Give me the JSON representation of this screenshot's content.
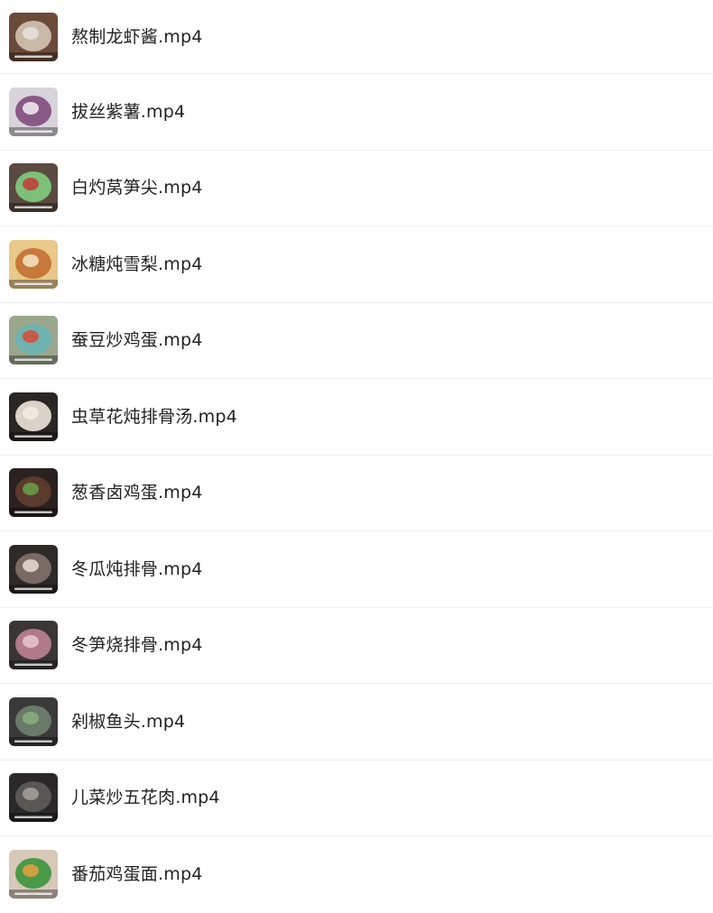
{
  "files": [
    {
      "name": "熬制龙虾酱.mp4",
      "thumb_bg": "#6b4a3a",
      "thumb_fg": "#c9b8a8",
      "thumb_accent": "#e8e2dc",
      "icon": "video-thumbnail-icon"
    },
    {
      "name": "拔丝紫薯.mp4",
      "thumb_bg": "#d9d4dc",
      "thumb_fg": "#8a5a86",
      "thumb_accent": "#f2eef2",
      "icon": "video-thumbnail-icon"
    },
    {
      "name": "白灼莴笋尖.mp4",
      "thumb_bg": "#5b4a3f",
      "thumb_fg": "#7cc07a",
      "thumb_accent": "#c43a3a",
      "icon": "video-thumbnail-icon"
    },
    {
      "name": "冰糖炖雪梨.mp4",
      "thumb_bg": "#e8c98a",
      "thumb_fg": "#c8783a",
      "thumb_accent": "#f4e6c2",
      "icon": "video-thumbnail-icon"
    },
    {
      "name": "蚕豆炒鸡蛋.mp4",
      "thumb_bg": "#9aa78c",
      "thumb_fg": "#6fb3b0",
      "thumb_accent": "#d84a3a",
      "icon": "video-thumbnail-icon"
    },
    {
      "name": "虫草花炖排骨汤.mp4",
      "thumb_bg": "#2a2624",
      "thumb_fg": "#d9d2c8",
      "thumb_accent": "#f2ede6",
      "icon": "video-thumbnail-icon"
    },
    {
      "name": "葱香卤鸡蛋.mp4",
      "thumb_bg": "#2a2220",
      "thumb_fg": "#5a3a2c",
      "thumb_accent": "#6aa04a",
      "icon": "video-thumbnail-icon"
    },
    {
      "name": "冬瓜炖排骨.mp4",
      "thumb_bg": "#2e2a28",
      "thumb_fg": "#7a6a64",
      "thumb_accent": "#e8dcd4",
      "icon": "video-thumbnail-icon"
    },
    {
      "name": "冬笋烧排骨.mp4",
      "thumb_bg": "#3a3636",
      "thumb_fg": "#b07a8a",
      "thumb_accent": "#e8c8d0",
      "icon": "video-thumbnail-icon"
    },
    {
      "name": "剁椒鱼头.mp4",
      "thumb_bg": "#3a3a3a",
      "thumb_fg": "#6a7a6a",
      "thumb_accent": "#8ab07a",
      "icon": "video-thumbnail-icon"
    },
    {
      "name": "儿菜炒五花肉.mp4",
      "thumb_bg": "#2a2828",
      "thumb_fg": "#5a5654",
      "thumb_accent": "#a8a09a",
      "icon": "video-thumbnail-icon"
    },
    {
      "name": "番茄鸡蛋面.mp4",
      "thumb_bg": "#d8c8b8",
      "thumb_fg": "#4a9a4a",
      "thumb_accent": "#e8a040",
      "icon": "video-thumbnail-icon"
    }
  ]
}
